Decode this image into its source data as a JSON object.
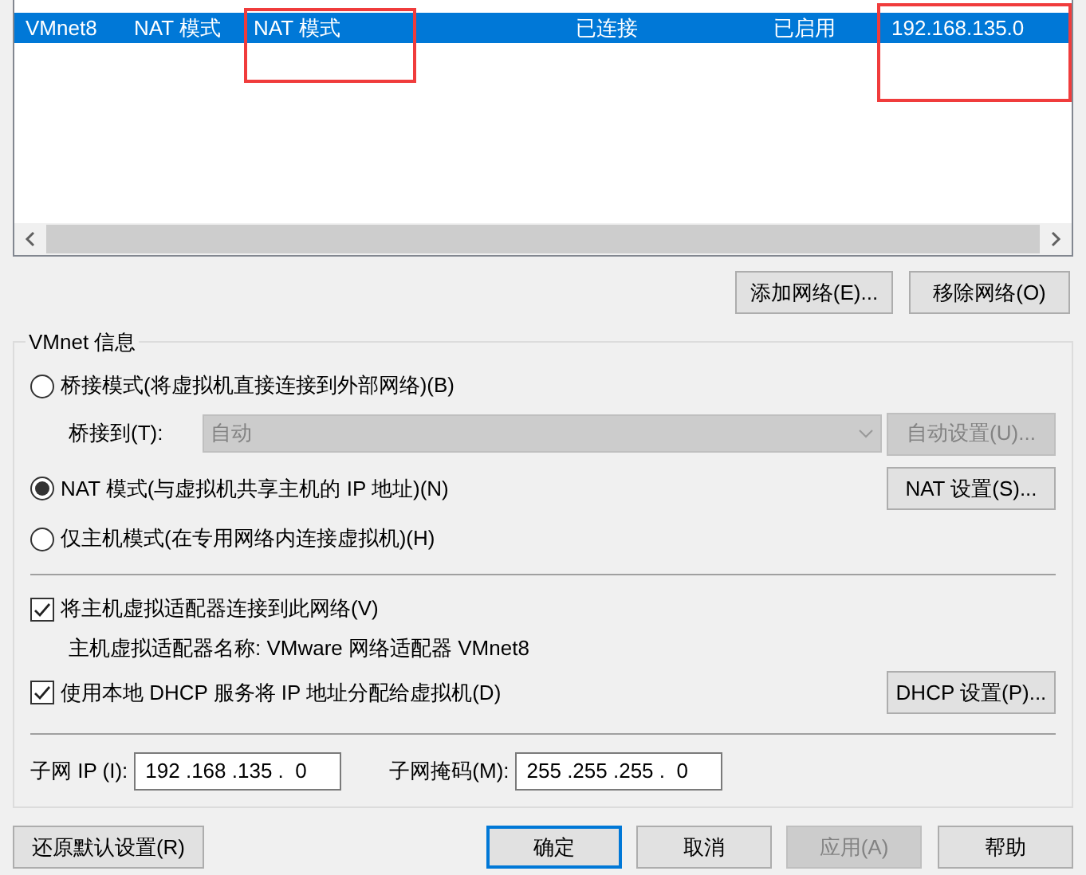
{
  "network_table": {
    "rows": [
      {
        "selected": true,
        "cells": [
          {
            "text": "VMnet8",
            "highlighted": false
          },
          {
            "text": "NAT 模式",
            "highlighted": false
          },
          {
            "text": "NAT 模式",
            "highlighted": true
          },
          {
            "text": "已连接",
            "highlighted": false
          },
          {
            "text": "已启用",
            "highlighted": false
          },
          {
            "text": "192.168.135.0",
            "highlighted": true
          }
        ]
      }
    ]
  },
  "table_buttons": [
    {
      "label": "添加网络(E)...",
      "disabled": false
    },
    {
      "label": "移除网络(O)",
      "disabled": false
    }
  ],
  "vmnet_info": {
    "title": "VMnet 信息",
    "modes": [
      {
        "label": "桥接模式(将虚拟机直接连接到外部网络)(B)",
        "selected": false
      },
      {
        "label": "NAT 模式(与虚拟机共享主机的 IP 地址)(N)",
        "selected": true
      },
      {
        "label": "仅主机模式(在专用网络内连接虚拟机)(H)",
        "selected": false
      }
    ],
    "bridge_to": {
      "label": "桥接到(T):",
      "value": "自动",
      "disabled": true,
      "button": {
        "label": "自动设置(U)...",
        "disabled": true
      }
    },
    "nat_button": {
      "label": "NAT 设置(S)...",
      "disabled": false
    },
    "connect_adapter": {
      "label": "将主机虚拟适配器连接到此网络(V)",
      "checked": true
    },
    "adapter_name": "主机虚拟适配器名称: VMware 网络适配器 VMnet8",
    "use_dhcp": {
      "label": "使用本地 DHCP 服务将 IP 地址分配给虚拟机(D)",
      "checked": true
    },
    "dhcp_button": {
      "label": "DHCP 设置(P)...",
      "disabled": false
    },
    "subnet_ip": {
      "label": "子网 IP (I):",
      "value": "192 .168 .135 .  0"
    },
    "subnet_mask": {
      "label": "子网掩码(M):",
      "value": "255 .255 .255 .  0"
    }
  },
  "footer_buttons": [
    {
      "label": "还原默认设置(R)",
      "disabled": false,
      "default": false
    },
    {
      "label": "确定",
      "disabled": false,
      "default": true
    },
    {
      "label": "取消",
      "disabled": false,
      "default": false
    },
    {
      "label": "应用(A)",
      "disabled": true,
      "default": false
    },
    {
      "label": "帮助",
      "disabled": false,
      "default": false
    }
  ]
}
